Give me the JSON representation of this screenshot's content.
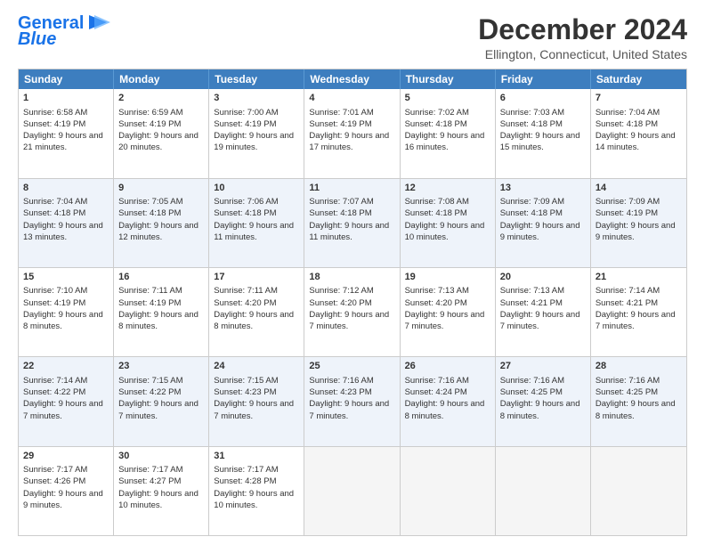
{
  "logo": {
    "line1": "General",
    "line2": "Blue"
  },
  "header": {
    "month": "December 2024",
    "location": "Ellington, Connecticut, United States"
  },
  "weekdays": [
    "Sunday",
    "Monday",
    "Tuesday",
    "Wednesday",
    "Thursday",
    "Friday",
    "Saturday"
  ],
  "weeks": [
    [
      {
        "day": "1",
        "sunrise": "Sunrise: 6:58 AM",
        "sunset": "Sunset: 4:19 PM",
        "daylight": "Daylight: 9 hours and 21 minutes."
      },
      {
        "day": "2",
        "sunrise": "Sunrise: 6:59 AM",
        "sunset": "Sunset: 4:19 PM",
        "daylight": "Daylight: 9 hours and 20 minutes."
      },
      {
        "day": "3",
        "sunrise": "Sunrise: 7:00 AM",
        "sunset": "Sunset: 4:19 PM",
        "daylight": "Daylight: 9 hours and 19 minutes."
      },
      {
        "day": "4",
        "sunrise": "Sunrise: 7:01 AM",
        "sunset": "Sunset: 4:19 PM",
        "daylight": "Daylight: 9 hours and 17 minutes."
      },
      {
        "day": "5",
        "sunrise": "Sunrise: 7:02 AM",
        "sunset": "Sunset: 4:18 PM",
        "daylight": "Daylight: 9 hours and 16 minutes."
      },
      {
        "day": "6",
        "sunrise": "Sunrise: 7:03 AM",
        "sunset": "Sunset: 4:18 PM",
        "daylight": "Daylight: 9 hours and 15 minutes."
      },
      {
        "day": "7",
        "sunrise": "Sunrise: 7:04 AM",
        "sunset": "Sunset: 4:18 PM",
        "daylight": "Daylight: 9 hours and 14 minutes."
      }
    ],
    [
      {
        "day": "8",
        "sunrise": "Sunrise: 7:04 AM",
        "sunset": "Sunset: 4:18 PM",
        "daylight": "Daylight: 9 hours and 13 minutes."
      },
      {
        "day": "9",
        "sunrise": "Sunrise: 7:05 AM",
        "sunset": "Sunset: 4:18 PM",
        "daylight": "Daylight: 9 hours and 12 minutes."
      },
      {
        "day": "10",
        "sunrise": "Sunrise: 7:06 AM",
        "sunset": "Sunset: 4:18 PM",
        "daylight": "Daylight: 9 hours and 11 minutes."
      },
      {
        "day": "11",
        "sunrise": "Sunrise: 7:07 AM",
        "sunset": "Sunset: 4:18 PM",
        "daylight": "Daylight: 9 hours and 11 minutes."
      },
      {
        "day": "12",
        "sunrise": "Sunrise: 7:08 AM",
        "sunset": "Sunset: 4:18 PM",
        "daylight": "Daylight: 9 hours and 10 minutes."
      },
      {
        "day": "13",
        "sunrise": "Sunrise: 7:09 AM",
        "sunset": "Sunset: 4:18 PM",
        "daylight": "Daylight: 9 hours and 9 minutes."
      },
      {
        "day": "14",
        "sunrise": "Sunrise: 7:09 AM",
        "sunset": "Sunset: 4:19 PM",
        "daylight": "Daylight: 9 hours and 9 minutes."
      }
    ],
    [
      {
        "day": "15",
        "sunrise": "Sunrise: 7:10 AM",
        "sunset": "Sunset: 4:19 PM",
        "daylight": "Daylight: 9 hours and 8 minutes."
      },
      {
        "day": "16",
        "sunrise": "Sunrise: 7:11 AM",
        "sunset": "Sunset: 4:19 PM",
        "daylight": "Daylight: 9 hours and 8 minutes."
      },
      {
        "day": "17",
        "sunrise": "Sunrise: 7:11 AM",
        "sunset": "Sunset: 4:20 PM",
        "daylight": "Daylight: 9 hours and 8 minutes."
      },
      {
        "day": "18",
        "sunrise": "Sunrise: 7:12 AM",
        "sunset": "Sunset: 4:20 PM",
        "daylight": "Daylight: 9 hours and 7 minutes."
      },
      {
        "day": "19",
        "sunrise": "Sunrise: 7:13 AM",
        "sunset": "Sunset: 4:20 PM",
        "daylight": "Daylight: 9 hours and 7 minutes."
      },
      {
        "day": "20",
        "sunrise": "Sunrise: 7:13 AM",
        "sunset": "Sunset: 4:21 PM",
        "daylight": "Daylight: 9 hours and 7 minutes."
      },
      {
        "day": "21",
        "sunrise": "Sunrise: 7:14 AM",
        "sunset": "Sunset: 4:21 PM",
        "daylight": "Daylight: 9 hours and 7 minutes."
      }
    ],
    [
      {
        "day": "22",
        "sunrise": "Sunrise: 7:14 AM",
        "sunset": "Sunset: 4:22 PM",
        "daylight": "Daylight: 9 hours and 7 minutes."
      },
      {
        "day": "23",
        "sunrise": "Sunrise: 7:15 AM",
        "sunset": "Sunset: 4:22 PM",
        "daylight": "Daylight: 9 hours and 7 minutes."
      },
      {
        "day": "24",
        "sunrise": "Sunrise: 7:15 AM",
        "sunset": "Sunset: 4:23 PM",
        "daylight": "Daylight: 9 hours and 7 minutes."
      },
      {
        "day": "25",
        "sunrise": "Sunrise: 7:16 AM",
        "sunset": "Sunset: 4:23 PM",
        "daylight": "Daylight: 9 hours and 7 minutes."
      },
      {
        "day": "26",
        "sunrise": "Sunrise: 7:16 AM",
        "sunset": "Sunset: 4:24 PM",
        "daylight": "Daylight: 9 hours and 8 minutes."
      },
      {
        "day": "27",
        "sunrise": "Sunrise: 7:16 AM",
        "sunset": "Sunset: 4:25 PM",
        "daylight": "Daylight: 9 hours and 8 minutes."
      },
      {
        "day": "28",
        "sunrise": "Sunrise: 7:16 AM",
        "sunset": "Sunset: 4:25 PM",
        "daylight": "Daylight: 9 hours and 8 minutes."
      }
    ],
    [
      {
        "day": "29",
        "sunrise": "Sunrise: 7:17 AM",
        "sunset": "Sunset: 4:26 PM",
        "daylight": "Daylight: 9 hours and 9 minutes."
      },
      {
        "day": "30",
        "sunrise": "Sunrise: 7:17 AM",
        "sunset": "Sunset: 4:27 PM",
        "daylight": "Daylight: 9 hours and 10 minutes."
      },
      {
        "day": "31",
        "sunrise": "Sunrise: 7:17 AM",
        "sunset": "Sunset: 4:28 PM",
        "daylight": "Daylight: 9 hours and 10 minutes."
      },
      null,
      null,
      null,
      null
    ]
  ]
}
